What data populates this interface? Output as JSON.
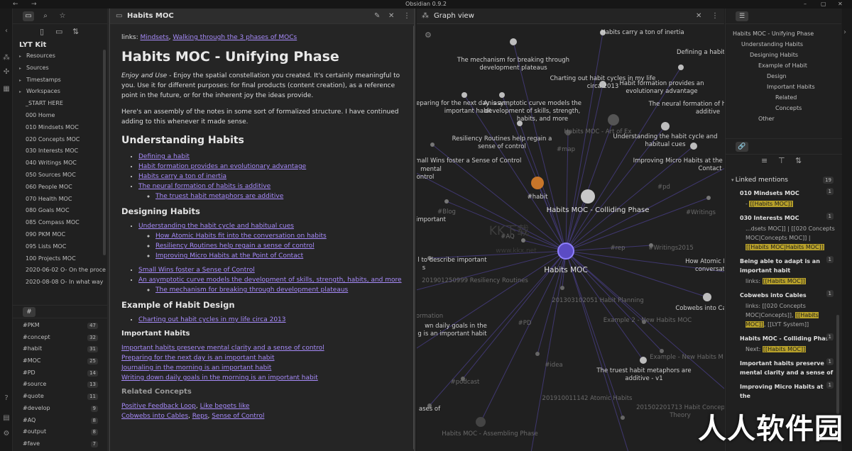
{
  "window": {
    "title": "Obsidian 0.9.2",
    "back": "←",
    "forward": "→",
    "minimize": "–",
    "maximize": "▢",
    "close": "✕"
  },
  "ribbon": {
    "icons": [
      "collapse-icon",
      "graph-icon",
      "puzzle-icon",
      "calendar-icon",
      "help-icon",
      "vault-icon",
      "settings-icon"
    ]
  },
  "left_sidebar": {
    "vault_name": "LYT Kit",
    "files": [
      {
        "label": "Resources",
        "folder": true
      },
      {
        "label": "Sources",
        "folder": true
      },
      {
        "label": "Timestamps",
        "folder": true
      },
      {
        "label": "Workspaces",
        "folder": true
      },
      {
        "label": "_START HERE",
        "folder": false
      },
      {
        "label": "000 Home",
        "folder": false
      },
      {
        "label": "010 Mindsets MOC",
        "folder": false
      },
      {
        "label": "020 Concepts MOC",
        "folder": false
      },
      {
        "label": "030 Interests MOC",
        "folder": false
      },
      {
        "label": "040 Writings MOC",
        "folder": false
      },
      {
        "label": "050 Sources MOC",
        "folder": false
      },
      {
        "label": "060 People MOC",
        "folder": false
      },
      {
        "label": "070 Health MOC",
        "folder": false
      },
      {
        "label": "080 Goals MOC",
        "folder": false
      },
      {
        "label": "085 Compass MOC",
        "folder": false
      },
      {
        "label": "090 PKM MOC",
        "folder": false
      },
      {
        "label": "095 Lists MOC",
        "folder": false
      },
      {
        "label": "100 Projects MOC",
        "folder": false
      },
      {
        "label": "2020-06-02 O- On the proce",
        "folder": false
      },
      {
        "label": "2020-08-08 O- In what way",
        "folder": false
      }
    ],
    "tag_tab_label": "#",
    "tags": [
      {
        "name": "#PKM",
        "count": "47"
      },
      {
        "name": "#concept",
        "count": "32"
      },
      {
        "name": "#habit",
        "count": "31"
      },
      {
        "name": "#MOC",
        "count": "25"
      },
      {
        "name": "#PD",
        "count": "14"
      },
      {
        "name": "#source",
        "count": "13"
      },
      {
        "name": "#quote",
        "count": "11"
      },
      {
        "name": "#develop",
        "count": "9"
      },
      {
        "name": "#AQ",
        "count": "8"
      },
      {
        "name": "#output",
        "count": "8"
      },
      {
        "name": "#fave",
        "count": "7"
      }
    ]
  },
  "note": {
    "tab_title": "Habits MOC",
    "links_prefix": "links: ",
    "link_mindsets": "Mindsets",
    "link_sep": ", ",
    "link_walking": "Walking through the 3 phases of MOCs",
    "h1": "Habits MOC - Unifying Phase",
    "intro_em": "Enjoy and Use",
    "intro_rest": " - Enjoy the spatial constellation you created. It's certainly meaningful to you. Use it for different purposes: for final products (content creation), as a reference point in the future, or for the inherent joy the ideas provide.",
    "assembly": "Here's an assembly of the notes in some sort of formalized structure. I have continued adding to this whenever it made sense.",
    "h2_understanding": "Understanding Habits",
    "understanding": {
      "a": "Defining a habit",
      "b": "Habit formation provides an evolutionary advantage",
      "c": "Habits carry a ton of inertia",
      "d": "The neural formation of habits is additive",
      "d_sub": "The truest habit metaphors are additive"
    },
    "h3_designing": "Designing Habits",
    "designing": {
      "a": "Understanding the habit cycle and habitual cues",
      "a1": "How Atomic Habits fit into the conversation on habits",
      "a2": "Resiliency Routines help regain a sense of control",
      "a3": "Improving Micro Habits at the Point of Contact",
      "b": "Small Wins foster a Sense of Control",
      "c": "An asymptotic curve models the development of skills, strength, habits, and more",
      "c1": "The mechanism for breaking through development plateaus"
    },
    "h3_example": "Example of Habit Design",
    "example_a": "Charting out habit cycles in my life circa 2013",
    "h4_important": "Important Habits",
    "important": [
      "Important habits preserve mental clarity and a sense of control",
      "Preparing for the next day is an important habit",
      "Journaling in the morning is an important habit",
      "Writing down daily goals in the morning is an important habit"
    ],
    "h4_related": "Related Concepts",
    "related": {
      "r1a": "Positive Feedback Loop",
      "r1b": "Like begets like",
      "r2a": "Cobwebs into Cables",
      "r2b": "Reps",
      "r2c": "Sense of Control"
    }
  },
  "graph": {
    "tab_title": "Graph view",
    "center": "Habits MOC",
    "labels": {
      "top_cut": "Habits carry a ton of inertia",
      "defining": "Defining a habit",
      "mechanism1": "The mechanism for breaking through",
      "mechanism2": "development plateaus",
      "charting1": "Charting out habit cycles in my life",
      "charting2": "circa 2013",
      "formation1": "Habit formation provides an",
      "formation2": "evolutionary advantage",
      "neural1": "The neural formation of habits is",
      "neural2": "additive",
      "preparing1": "Preparing for the next day is an",
      "preparing2": "important habit",
      "asym1": "An asymptotic curve models the",
      "asym2": "development of skills, strength,",
      "asym3": "habits, and more",
      "artless": "Habits MOC - Art of Ex",
      "understanding1": "Understanding the habit cycle and",
      "understanding2": "habitual cues",
      "resiliency1": "Resiliency Routines help regain a",
      "resiliency2": "sense of control",
      "map": "#map",
      "smallwins1": "Small Wins foster a Sense of Control",
      "smallwins2": "mental",
      "smallwins3": "ontrol",
      "micro1": "Improving Micro Habits at the Point of",
      "micro2": "Contact",
      "habit_tag": "#habit",
      "pd1": "#pd",
      "colliding": "Habits MOC - Colliding Phase",
      "blog": "#Blog",
      "writings": "#Writings",
      "important": "important",
      "aq": "#AQ",
      "rep": "#rep",
      "writings2015": "#Writings2015",
      "describe1": "l to describe important",
      "describe2": "s",
      "atomic1": "How Atomic H",
      "atomic2": "conversat",
      "resroutines": "201901250999 Resiliency Routines",
      "planning": "201303102051 Habit Planning",
      "cobwebs": "Cobwebs into Ca",
      "formation_cut": "ormation",
      "example2": "Example 2 - New Habits MOC",
      "pd2": "#PD",
      "daily1": "wn daily goals in the",
      "daily2": "g is an important habit",
      "examplenew": "Example - New Habits M",
      "idea": "#idea",
      "truest1": "The truest habit metaphors are",
      "truest2": "additive - v1",
      "podcast": "#podcast",
      "atomic_habits": "201910011142 Atomic Habits",
      "habit_concepts": "201502201713 Habit Concepts an",
      "theory": "Theory",
      "phases": "ases of",
      "assembling": "Habits MOC - Assembling Phase",
      "watermark_kk": "KK下载",
      "watermark_url": "www.kkx.net"
    }
  },
  "right_sidebar": {
    "outline_tab": "☰",
    "outline": [
      {
        "label": "Habits MOC - Unifying Phase",
        "level": 0
      },
      {
        "label": "Understanding Habits",
        "level": 1
      },
      {
        "label": "Designing Habits",
        "level": 2
      },
      {
        "label": "Example of Habit",
        "level": 3
      },
      {
        "label": "Design",
        "level": 4
      },
      {
        "label": "Important Habits",
        "level": 4
      },
      {
        "label": "Related",
        "level": 5
      },
      {
        "label": "Concepts",
        "level": 5
      },
      {
        "label": "Other",
        "level": 3
      }
    ],
    "linked_title": "Linked mentions",
    "linked_count": "19",
    "mentions": {
      "m1_name": "010 Mindsets MOC",
      "m1_count": "1",
      "m1_pre": "- ",
      "m1_hl": "[[Habits MOC]]",
      "m2_name": "030 Interests MOC",
      "m2_count": "1",
      "m2_pre": "...dsets MOC]] | [[020 Concepts MOC|Concepts MOC]] | ",
      "m2_hl": "[[Habits MOC|Habits MOC]]",
      "m3_name": "Being able to adapt is an important habit",
      "m3_count": "1",
      "m3_pre": "links: ",
      "m3_hl": "[[Habits MOC]]",
      "m4_name": "Cobwebs into Cables",
      "m4_count": "1",
      "m4_pre": "links: [[020 Concepts MOC|Concepts]], ",
      "m4_hl": "[[Habits MOC]]",
      "m4_post": ", [[LYT System]]",
      "m5_name": "Habits MOC - Colliding Phase",
      "m5_count": "1",
      "m5_pre": "Next: ",
      "m5_hl": "[[Habits MOC]]",
      "m6_name": "Important habits preserve mental clarity and a sense of",
      "m6_count": "1",
      "m7_name": "Improving Micro Habits at the",
      "m7_count": "1"
    }
  },
  "watermark": "人人软件园",
  "colors": {
    "accent": "#a78bfa",
    "node_center": "#5b4bc4",
    "node_tag": "#c8762a",
    "highlight": "#b8a12a"
  }
}
